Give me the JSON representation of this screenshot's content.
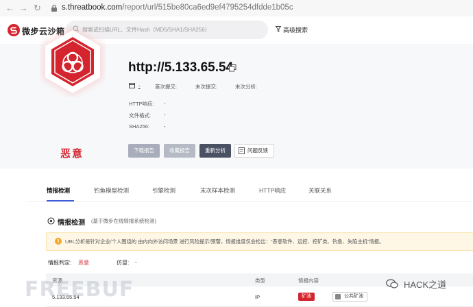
{
  "browser": {
    "back_glyph": "←",
    "forward_glyph": "→",
    "reload_glyph": "↻",
    "url_host": "s.threatbook.com",
    "url_path": "/report/url/515be80ca6ed9ef4795254dfdde1b05c"
  },
  "header": {
    "logo_text": "微步云沙箱",
    "search_placeholder": "搜索或扫描URL、文件Hash（MD5/SHA1/SHA256）",
    "advanced_search": "高级搜索"
  },
  "report": {
    "title": "http://5.133.65.54",
    "type_value": "-",
    "first_submit_label": "首次提交:",
    "last_submit_label": "末次提交:",
    "last_analysis_label": "末次分析:",
    "http_resp_label": "HTTP响应:",
    "http_resp_value": "-",
    "file_format_label": "文件格式:",
    "file_format_value": "-",
    "sha256_label": "SHA256:",
    "sha256_value": "-",
    "verdict": "恶意",
    "verdict_color": "#d4252f",
    "buttons": {
      "download": "下载报告",
      "favorite": "收藏报告",
      "reanalyze": "重新分析",
      "feedback": "问题反馈"
    }
  },
  "tabs": [
    "情报检测",
    "钓鱼模型检测",
    "引擎检测",
    "末次样本检测",
    "HTTP响应",
    "关联关系"
  ],
  "section": {
    "title": "情报检测",
    "subtitle": "(基于微步在线情报系统检测)",
    "alert": "URL分析是针对企业/个人围绕的 由内向外访问场景 进行风险提示/预警，情报维度仅会检出：“恶意软件、远控、挖矿类、钓鱼、失陷主机”情报。",
    "judgement_label": "情报判定:",
    "judgement_value": "恶意",
    "counterfeit_label": "仿冒:",
    "counterfeit_value": "-"
  },
  "table": {
    "headers": [
      "资源",
      "类型",
      "情报内容"
    ],
    "rows": [
      {
        "resource": "5.133.65.54",
        "type": "IP",
        "tag_red": "矿池",
        "tag_gray": "公共矿池"
      }
    ]
  },
  "watermarks": {
    "left": "FREEBUF",
    "right": "HACK之道"
  }
}
